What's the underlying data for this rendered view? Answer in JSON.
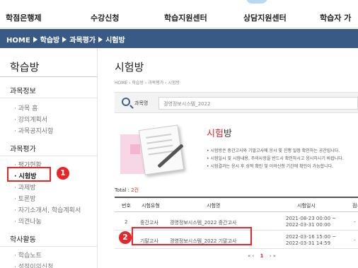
{
  "gnb": {
    "items": [
      "학점은행제",
      "수강신청",
      "학습지원센터",
      "상담지원센터",
      "학습자 가"
    ]
  },
  "breadcrumb": {
    "home": "HOME",
    "path1": "학습방",
    "path2": "과목평가",
    "path3": "시험방"
  },
  "sidebar": {
    "title": "학습방",
    "sections": [
      {
        "label": "과목정보",
        "items": [
          "· 과목 홈",
          "· 강의계획서",
          "· 과목공지사항"
        ]
      },
      {
        "label": "과목평가",
        "items": [
          "· 평가현황",
          "· 시험방",
          "· 과제방",
          "· 토론방",
          "· 자기소개서, 학습계획서",
          "· 의견나눔"
        ]
      },
      {
        "label": "학사활동",
        "items": [
          "· 학습노트",
          "· 성적이의신청"
        ]
      }
    ],
    "active_item": "· 시험방"
  },
  "callouts": {
    "one": "1",
    "two": "2"
  },
  "content": {
    "title": "시험방",
    "location": "HOME  ›  학습방  ›  과목평가  ›  시험방",
    "search": {
      "label": "과목명",
      "value": "경영정보시스템_2022"
    },
    "intro": {
      "heading_red": "시험",
      "heading_rest": "방",
      "lines": [
        "• 시험방은 중간고사와 기말고사에 응시 및 진행 일정 확인하는 공간입니다.",
        "• 시험일시 및 시험내용, 주의사항을 반드시 확인하시고 응시하시기 바랍니다.",
        "• 시험결과는 응시 후 성적 확인 및 이의신청 기간에 확인이 가능합니다."
      ]
    },
    "total_label": "Total : ",
    "total_value": "2건",
    "table": {
      "headers": [
        "번호",
        "시험유형",
        "시험명",
        "시험일시",
        "점수"
      ],
      "rows": [
        {
          "no": "2",
          "type": "중간고사",
          "name": "경영정보시스템_2022 중간고사",
          "start": "2021-08-23 00:00 ~",
          "end": "2022-03-31 00:00",
          "score": "-"
        },
        {
          "no": "1",
          "type": "기말고사",
          "name": "경영정보시스템_2022 기말고사",
          "start": "2022-03-16 15:00 ~",
          "end": "2022-03-31 14:59",
          "score": "-"
        }
      ]
    },
    "pager": {
      "first": "«",
      "prev": "‹",
      "current": "1",
      "next": "›",
      "last": "»"
    }
  },
  "colors": {
    "accent": "#e8262a",
    "nav_bar": "#3a5a86"
  },
  "icons": [
    "search-icon",
    "chevron-right-icon"
  ]
}
